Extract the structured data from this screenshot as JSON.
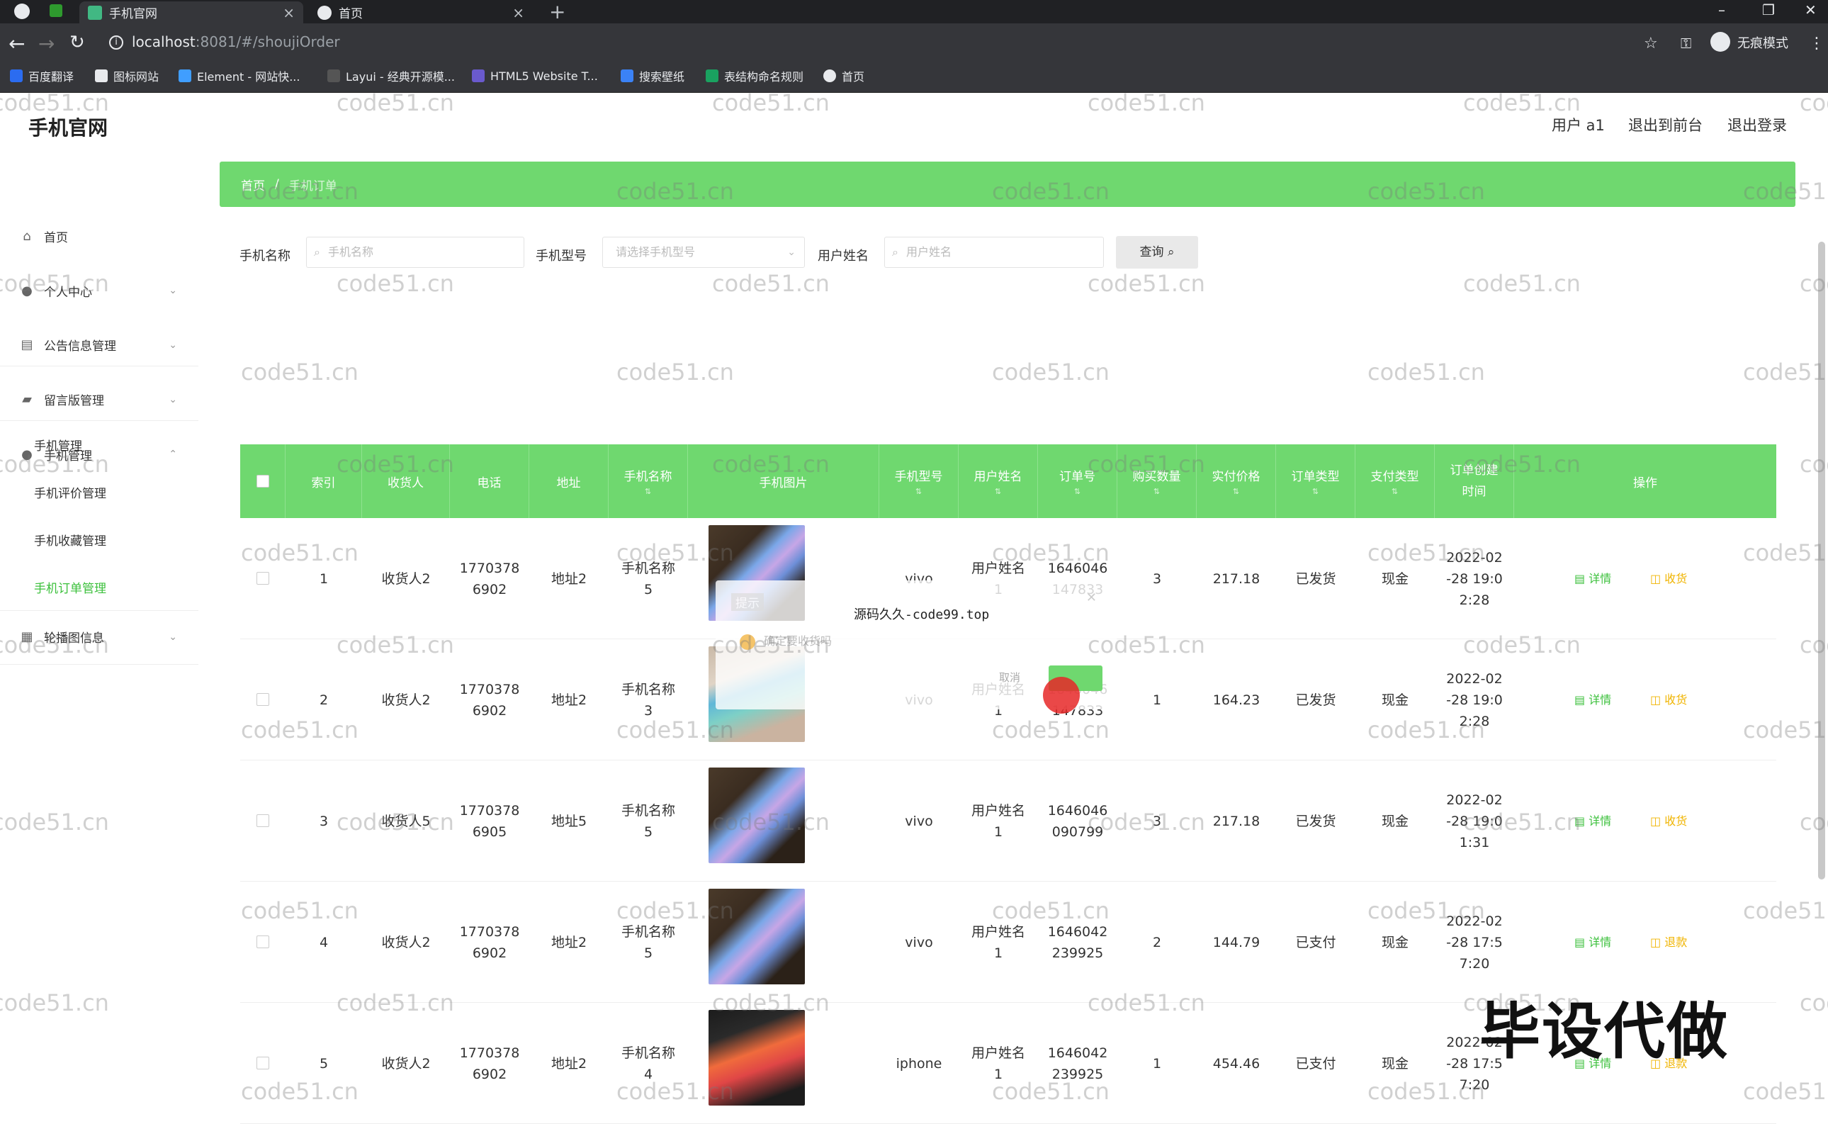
{
  "browser": {
    "tabs": [
      {
        "title": "手机官网",
        "active": true
      },
      {
        "title": "首页",
        "active": false
      }
    ],
    "url_host": "localhost",
    "url_rest": ":8081/#/shoujiOrder",
    "incognito_label": "无痕模式",
    "bookmarks": [
      "百度翻译",
      "图标网站",
      "Element - 网站快...",
      "Layui - 经典开源模...",
      "HTML5 Website T...",
      "搜索壁纸",
      "表结构命名规则",
      "首页"
    ]
  },
  "header": {
    "brand": "手机官网",
    "user": "用户 a1",
    "back_front": "退出到前台",
    "logout": "退出登录"
  },
  "sidebar": {
    "items": [
      {
        "label": "首页",
        "icon": "home-icon"
      },
      {
        "label": "个人中心",
        "icon": "user-icon"
      },
      {
        "label": "公告信息管理",
        "icon": "notice-icon"
      },
      {
        "label": "留言版管理",
        "icon": "message-icon"
      },
      {
        "label": "手机管理",
        "icon": "user-icon"
      },
      {
        "label": "轮播图信息",
        "icon": "grid-icon"
      }
    ],
    "sub_items": [
      "手机管理",
      "手机评价管理",
      "手机收藏管理",
      "手机订单管理"
    ]
  },
  "breadcrumb": {
    "home": "首页",
    "sep": "/",
    "current": "手机订单"
  },
  "filters": {
    "phone_name_label": "手机名称",
    "phone_name_placeholder": "手机名称",
    "phone_type_label": "手机型号",
    "phone_type_placeholder": "请选择手机型号",
    "user_name_label": "用户姓名",
    "user_name_placeholder": "用户姓名",
    "query_button": "查询"
  },
  "table": {
    "headers": [
      "索引",
      "收货人",
      "电话",
      "地址",
      "手机名称",
      "手机图片",
      "手机型号",
      "用户姓名",
      "订单号",
      "购买数量",
      "实付价格",
      "订单类型",
      "支付类型",
      "订单创建时间",
      "操作"
    ],
    "rows": [
      {
        "index": "1",
        "consignee": "收货人2",
        "phone": "17703786902",
        "address": "地址2",
        "name": "手机名称5",
        "model": "vivo",
        "user": "用户姓名1",
        "order": "1646046147833",
        "qty": "3",
        "price": "217.18",
        "status": "已发货",
        "pay": "现金",
        "time": "2022-02-28 19:02:28",
        "detail": "详情",
        "action": "收货",
        "img": "blue"
      },
      {
        "index": "2",
        "consignee": "收货人2",
        "phone": "17703786902",
        "address": "地址2",
        "name": "手机名称3",
        "model": "vivo",
        "user": "用户姓名1",
        "order": "1646046147833",
        "qty": "1",
        "price": "164.23",
        "status": "已发货",
        "pay": "现金",
        "time": "2022-02-28 19:02:28",
        "detail": "详情",
        "action": "收货",
        "img": "hand"
      },
      {
        "index": "3",
        "consignee": "收货人5",
        "phone": "17703786905",
        "address": "地址5",
        "name": "手机名称5",
        "model": "vivo",
        "user": "用户姓名1",
        "order": "1646046090799",
        "qty": "3",
        "price": "217.18",
        "status": "已发货",
        "pay": "现金",
        "time": "2022-02-28 19:01:31",
        "detail": "详情",
        "action": "收货",
        "img": "blue"
      },
      {
        "index": "4",
        "consignee": "收货人2",
        "phone": "17703786902",
        "address": "地址2",
        "name": "手机名称5",
        "model": "vivo",
        "user": "用户姓名1",
        "order": "1646042239925",
        "qty": "2",
        "price": "144.79",
        "status": "已支付",
        "pay": "现金",
        "time": "2022-02-28 17:57:20",
        "detail": "详情",
        "action": "退款",
        "img": "blue"
      },
      {
        "index": "5",
        "consignee": "收货人2",
        "phone": "17703786902",
        "address": "地址2",
        "name": "手机名称4",
        "model": "iphone",
        "user": "用户姓名1",
        "order": "1646042239925",
        "qty": "1",
        "price": "454.46",
        "status": "已支付",
        "pay": "现金",
        "time": "2022-02-28 17:57:20",
        "detail": "详情",
        "action": "退款",
        "img": "red"
      }
    ]
  },
  "dialog": {
    "title": "提示",
    "message": "源码久久-code99.top",
    "question": "确定要收货吗",
    "cancel": "取消"
  },
  "watermark": {
    "text": "code51.cn",
    "big_text": "毕设代做"
  }
}
